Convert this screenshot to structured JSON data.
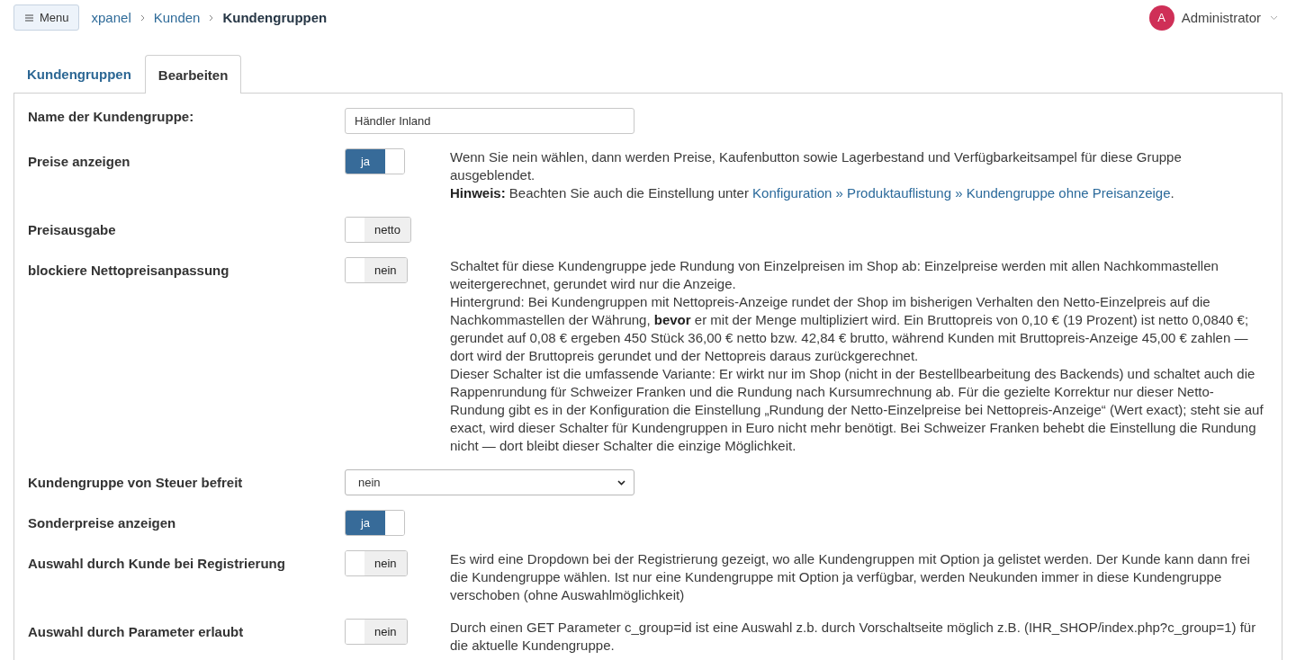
{
  "header": {
    "menu_button": "Menu",
    "breadcrumbs": [
      {
        "label": "xpanel",
        "current": false
      },
      {
        "label": "Kunden",
        "current": false
      },
      {
        "label": "Kundengruppen",
        "current": true
      }
    ],
    "user": {
      "initial": "A",
      "name": "Administrator"
    }
  },
  "tabs": [
    {
      "label": "Kundengruppen",
      "selected": false
    },
    {
      "label": "Bearbeiten",
      "selected": true
    }
  ],
  "settings": [
    {
      "kind": "text_field",
      "label": "Name der Kundengruppe:",
      "value": "Händler Inland"
    },
    {
      "kind": "toggle",
      "label": "Preise anzeigen",
      "toggle": {
        "on": true,
        "text": "ja"
      },
      "description": [
        {
          "text": "Wenn Sie nein wählen, dann werden Preise, Kaufenbutton sowie Lagerbestand und Verfügbarkeitsampel für diese Gruppe ausgeblendet."
        },
        {
          "text": "**Hinweis:** Beachten Sie auch die Einstellung unter ",
          "link": "Konfiguration » Produktauflistung » Kundengruppe ohne Preisanzeige",
          "after": "."
        }
      ]
    },
    {
      "kind": "toggle",
      "label": "Preisausgabe",
      "toggle": {
        "on": false,
        "text": "netto"
      }
    },
    {
      "kind": "toggle",
      "label": "blockiere Nettopreisanpassung",
      "toggle": {
        "on": false,
        "text": "nein"
      },
      "description": [
        {
          "text": "Schaltet für diese Kundengruppe jede Rundung von Einzelpreisen im Shop ab: Einzelpreise werden mit allen Nachkommastellen weitergerechnet, gerundet wird nur die Anzeige."
        },
        {
          "text": "Hintergrund: Bei Kundengruppen mit Nettopreis-Anzeige rundet der Shop im bisherigen Verhalten den Netto-Einzelpreis auf die Nachkommastellen der Währung, **bevor** er mit der Menge multipliziert wird. Ein Bruttopreis von 0,10 € (19 Prozent) ist netto 0,0840 €; gerundet auf 0,08 € ergeben 450 Stück 36,00 € netto bzw. 42,84 € brutto, während Kunden mit Bruttopreis-Anzeige 45,00 € zahlen — dort wird der Bruttopreis gerundet und der Nettopreis daraus zurückgerechnet."
        },
        {
          "text": "Dieser Schalter ist die umfassende Variante: Er wirkt nur im Shop (nicht in der Bestellbearbeitung des Backends) und schaltet auch die Rappenrundung für Schweizer Franken und die Rundung nach Kursumrechnung ab. Für die gezielte Korrektur nur dieser Netto-Rundung gibt es in der Konfiguration die Einstellung „Rundung der Netto-Einzelpreise bei Nettopreis-Anzeige“ (Wert exact); steht sie auf exact, wird dieser Schalter für Kundengruppen in Euro nicht mehr benötigt. Bei Schweizer Franken behebt die Einstellung die Rundung nicht — dort bleibt dieser Schalter die einzige Möglichkeit."
        }
      ]
    },
    {
      "kind": "select",
      "label": "Kundengruppe von Steuer befreit",
      "value": "nein"
    },
    {
      "kind": "toggle",
      "label": "Sonderpreise anzeigen",
      "toggle": {
        "on": true,
        "text": "ja"
      }
    },
    {
      "kind": "toggle",
      "label": "Auswahl durch Kunde bei Registrierung",
      "toggle": {
        "on": false,
        "text": "nein"
      },
      "description": [
        {
          "text": "Es wird eine Dropdown bei der Registrierung gezeigt, wo alle Kundengruppen mit Option ja gelistet werden. Der Kunde kann dann frei die Kundengruppe wählen. Ist nur eine Kundengruppe mit Option ja verfügbar, werden Neukunden immer in diese Kundengruppe verschoben (ohne Auswahlmöglichkeit)"
        }
      ]
    },
    {
      "kind": "toggle",
      "label": "Auswahl durch Parameter erlaubt",
      "toggle": {
        "on": false,
        "text": "nein"
      },
      "description": [
        {
          "text": "Durch einen GET Parameter c_group=id ist eine Auswahl z.b. durch Vorschaltseite möglich z.B. (IHR_SHOP/index.php?c_group=1) für die aktuelle Kundengruppe."
        }
      ]
    }
  ]
}
